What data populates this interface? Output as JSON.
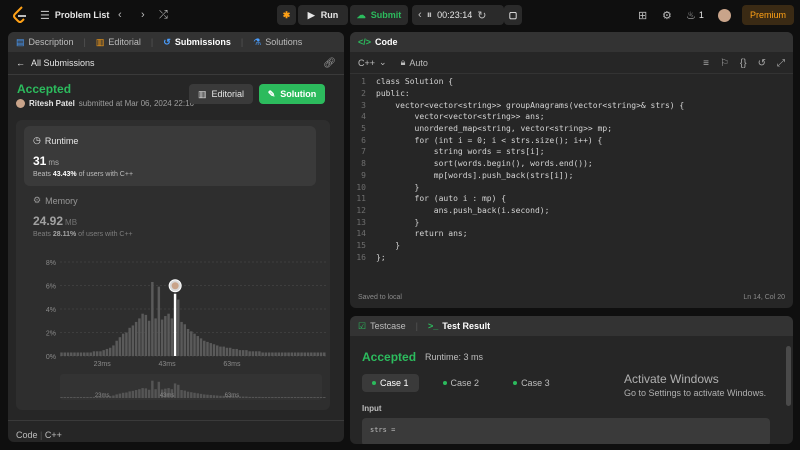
{
  "topbar": {
    "problem_list": "Problem List",
    "run": "Run",
    "submit": "Submit",
    "timer": "00:23:14",
    "streak": "1",
    "premium": "Premium",
    "accent": "#ffa116"
  },
  "left": {
    "tabs": [
      "Description",
      "Editorial",
      "Submissions",
      "Solutions"
    ],
    "all_submissions": "All Submissions",
    "status": "Accepted",
    "user": "Ritesh Patel",
    "submitted_text": "submitted at Mar 06, 2024 22:16",
    "editorial_btn": "Editorial",
    "solution_btn": "Solution",
    "runtime": {
      "title": "Runtime",
      "value": "31",
      "unit": "ms",
      "beats_prefix": "Beats",
      "beats_value": "43.43%",
      "beats_suffix": "of users with C++"
    },
    "memory": {
      "title": "Memory",
      "value": "24.92",
      "unit": "MB",
      "beats_prefix": "Beats",
      "beats_value": "28.11%",
      "beats_suffix": "of users with C++"
    },
    "footer": {
      "code": "Code",
      "lang": "C++"
    }
  },
  "chart_data": {
    "type": "bar",
    "ylabel": "",
    "ylim": [
      0,
      8
    ],
    "yticks": [
      "0%",
      "2%",
      "4%",
      "6%",
      "8%"
    ],
    "xticks": [
      "23ms",
      "43ms",
      "63ms"
    ],
    "x_range_ms": [
      10,
      92
    ],
    "highlight_ms": 31,
    "values": [
      0.3,
      0.3,
      0.3,
      0.3,
      0.3,
      0.3,
      0.3,
      0.3,
      0.3,
      0.3,
      0.4,
      0.4,
      0.4,
      0.5,
      0.6,
      0.7,
      0.9,
      1.3,
      1.6,
      1.9,
      2.0,
      2.4,
      2.6,
      2.9,
      3.2,
      3.6,
      3.5,
      3.0,
      6.3,
      3.2,
      5.9,
      3.1,
      3.4,
      3.6,
      3.2,
      5.3,
      4.8,
      2.9,
      2.7,
      2.3,
      2.1,
      1.9,
      1.7,
      1.5,
      1.3,
      1.2,
      1.1,
      1.0,
      0.9,
      0.8,
      0.8,
      0.7,
      0.7,
      0.6,
      0.6,
      0.5,
      0.5,
      0.5,
      0.4,
      0.4,
      0.4,
      0.4,
      0.3,
      0.3,
      0.3,
      0.3,
      0.3,
      0.3,
      0.3,
      0.3,
      0.3,
      0.3,
      0.3,
      0.3,
      0.3,
      0.3,
      0.3,
      0.3,
      0.3,
      0.3,
      0.3,
      0.3
    ],
    "highlight_index": 35,
    "bar_color": "#5a5a5a",
    "highlight_color": "#ffffff"
  },
  "code": {
    "title": "Code",
    "language": "C++",
    "mode": "Auto",
    "lines": [
      "class Solution {",
      "public:",
      "    vector<vector<string>> groupAnagrams(vector<string>& strs) {",
      "        vector<vector<string>> ans;",
      "        unordered_map<string, vector<string>> mp;",
      "        for (int i = 0; i < strs.size(); i++) {",
      "            string words = strs[i];",
      "            sort(words.begin(), words.end());",
      "            mp[words].push_back(strs[i]);",
      "        }",
      "        for (auto i : mp) {",
      "            ans.push_back(i.second);",
      "        }",
      "        return ans;",
      "    }",
      "};"
    ],
    "saved": "Saved to local",
    "cursor": "Ln 14, Col 20"
  },
  "test": {
    "tabs": [
      "Testcase",
      "Test Result"
    ],
    "status": "Accepted",
    "runtime": "Runtime: 3 ms",
    "cases": [
      "Case 1",
      "Case 2",
      "Case 3"
    ],
    "input_label": "Input",
    "input_value": "strs ="
  },
  "watermark": {
    "line1": "Activate Windows",
    "line2": "Go to Settings to activate Windows."
  }
}
